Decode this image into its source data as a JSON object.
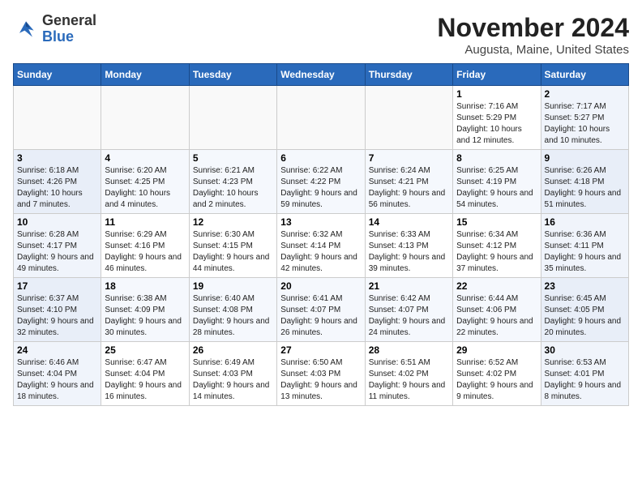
{
  "logo": {
    "general": "General",
    "blue": "Blue"
  },
  "title": "November 2024",
  "location": "Augusta, Maine, United States",
  "days_of_week": [
    "Sunday",
    "Monday",
    "Tuesday",
    "Wednesday",
    "Thursday",
    "Friday",
    "Saturday"
  ],
  "weeks": [
    [
      {
        "day": "",
        "info": ""
      },
      {
        "day": "",
        "info": ""
      },
      {
        "day": "",
        "info": ""
      },
      {
        "day": "",
        "info": ""
      },
      {
        "day": "",
        "info": ""
      },
      {
        "day": "1",
        "info": "Sunrise: 7:16 AM\nSunset: 5:29 PM\nDaylight: 10 hours and 12 minutes."
      },
      {
        "day": "2",
        "info": "Sunrise: 7:17 AM\nSunset: 5:27 PM\nDaylight: 10 hours and 10 minutes."
      }
    ],
    [
      {
        "day": "3",
        "info": "Sunrise: 6:18 AM\nSunset: 4:26 PM\nDaylight: 10 hours and 7 minutes."
      },
      {
        "day": "4",
        "info": "Sunrise: 6:20 AM\nSunset: 4:25 PM\nDaylight: 10 hours and 4 minutes."
      },
      {
        "day": "5",
        "info": "Sunrise: 6:21 AM\nSunset: 4:23 PM\nDaylight: 10 hours and 2 minutes."
      },
      {
        "day": "6",
        "info": "Sunrise: 6:22 AM\nSunset: 4:22 PM\nDaylight: 9 hours and 59 minutes."
      },
      {
        "day": "7",
        "info": "Sunrise: 6:24 AM\nSunset: 4:21 PM\nDaylight: 9 hours and 56 minutes."
      },
      {
        "day": "8",
        "info": "Sunrise: 6:25 AM\nSunset: 4:19 PM\nDaylight: 9 hours and 54 minutes."
      },
      {
        "day": "9",
        "info": "Sunrise: 6:26 AM\nSunset: 4:18 PM\nDaylight: 9 hours and 51 minutes."
      }
    ],
    [
      {
        "day": "10",
        "info": "Sunrise: 6:28 AM\nSunset: 4:17 PM\nDaylight: 9 hours and 49 minutes."
      },
      {
        "day": "11",
        "info": "Sunrise: 6:29 AM\nSunset: 4:16 PM\nDaylight: 9 hours and 46 minutes."
      },
      {
        "day": "12",
        "info": "Sunrise: 6:30 AM\nSunset: 4:15 PM\nDaylight: 9 hours and 44 minutes."
      },
      {
        "day": "13",
        "info": "Sunrise: 6:32 AM\nSunset: 4:14 PM\nDaylight: 9 hours and 42 minutes."
      },
      {
        "day": "14",
        "info": "Sunrise: 6:33 AM\nSunset: 4:13 PM\nDaylight: 9 hours and 39 minutes."
      },
      {
        "day": "15",
        "info": "Sunrise: 6:34 AM\nSunset: 4:12 PM\nDaylight: 9 hours and 37 minutes."
      },
      {
        "day": "16",
        "info": "Sunrise: 6:36 AM\nSunset: 4:11 PM\nDaylight: 9 hours and 35 minutes."
      }
    ],
    [
      {
        "day": "17",
        "info": "Sunrise: 6:37 AM\nSunset: 4:10 PM\nDaylight: 9 hours and 32 minutes."
      },
      {
        "day": "18",
        "info": "Sunrise: 6:38 AM\nSunset: 4:09 PM\nDaylight: 9 hours and 30 minutes."
      },
      {
        "day": "19",
        "info": "Sunrise: 6:40 AM\nSunset: 4:08 PM\nDaylight: 9 hours and 28 minutes."
      },
      {
        "day": "20",
        "info": "Sunrise: 6:41 AM\nSunset: 4:07 PM\nDaylight: 9 hours and 26 minutes."
      },
      {
        "day": "21",
        "info": "Sunrise: 6:42 AM\nSunset: 4:07 PM\nDaylight: 9 hours and 24 minutes."
      },
      {
        "day": "22",
        "info": "Sunrise: 6:44 AM\nSunset: 4:06 PM\nDaylight: 9 hours and 22 minutes."
      },
      {
        "day": "23",
        "info": "Sunrise: 6:45 AM\nSunset: 4:05 PM\nDaylight: 9 hours and 20 minutes."
      }
    ],
    [
      {
        "day": "24",
        "info": "Sunrise: 6:46 AM\nSunset: 4:04 PM\nDaylight: 9 hours and 18 minutes."
      },
      {
        "day": "25",
        "info": "Sunrise: 6:47 AM\nSunset: 4:04 PM\nDaylight: 9 hours and 16 minutes."
      },
      {
        "day": "26",
        "info": "Sunrise: 6:49 AM\nSunset: 4:03 PM\nDaylight: 9 hours and 14 minutes."
      },
      {
        "day": "27",
        "info": "Sunrise: 6:50 AM\nSunset: 4:03 PM\nDaylight: 9 hours and 13 minutes."
      },
      {
        "day": "28",
        "info": "Sunrise: 6:51 AM\nSunset: 4:02 PM\nDaylight: 9 hours and 11 minutes."
      },
      {
        "day": "29",
        "info": "Sunrise: 6:52 AM\nSunset: 4:02 PM\nDaylight: 9 hours and 9 minutes."
      },
      {
        "day": "30",
        "info": "Sunrise: 6:53 AM\nSunset: 4:01 PM\nDaylight: 9 hours and 8 minutes."
      }
    ]
  ]
}
